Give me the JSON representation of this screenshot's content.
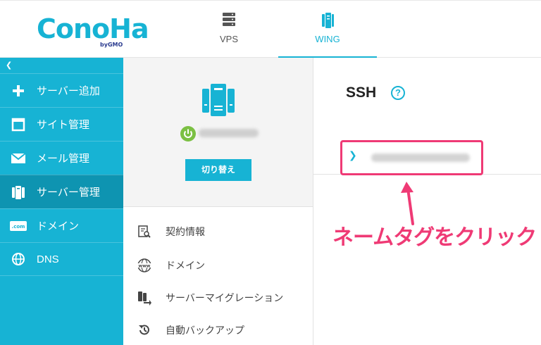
{
  "header": {
    "logo_text": "ConoHa",
    "logo_sub": "byGMO",
    "tabs": [
      {
        "label": "VPS",
        "icon": "server-stack-icon",
        "active": false
      },
      {
        "label": "WING",
        "icon": "mobile-server-icon",
        "active": true
      }
    ]
  },
  "sidebar": {
    "collapse_label": "❮",
    "items": [
      {
        "label": "サーバー追加",
        "icon": "plus-icon",
        "active": false
      },
      {
        "label": "サイト管理",
        "icon": "window-icon",
        "active": false
      },
      {
        "label": "メール管理",
        "icon": "mail-icon",
        "active": false
      },
      {
        "label": "サーバー管理",
        "icon": "server-icon",
        "active": true
      },
      {
        "label": "ドメイン",
        "icon": "domain-com-icon",
        "active": false
      },
      {
        "label": "DNS",
        "icon": "globe-icon",
        "active": false
      }
    ]
  },
  "middle": {
    "switch_button": "切り替え",
    "menu": [
      {
        "label": "契約情報",
        "icon": "contract-search-icon"
      },
      {
        "label": "ドメイン",
        "icon": "www-globe-icon"
      },
      {
        "label": "サーバーマイグレーション",
        "icon": "migration-icon"
      },
      {
        "label": "自動バックアップ",
        "icon": "backup-history-icon"
      }
    ]
  },
  "right": {
    "title": "SSH",
    "help_label": "?",
    "row_chevron": "❯"
  },
  "annotation": {
    "text": "ネームタグをクリック",
    "color": "#ef3a75"
  },
  "colors": {
    "accent": "#17b3d4",
    "sidebar_active": "#0e94b1",
    "power_on": "#7bc043"
  }
}
